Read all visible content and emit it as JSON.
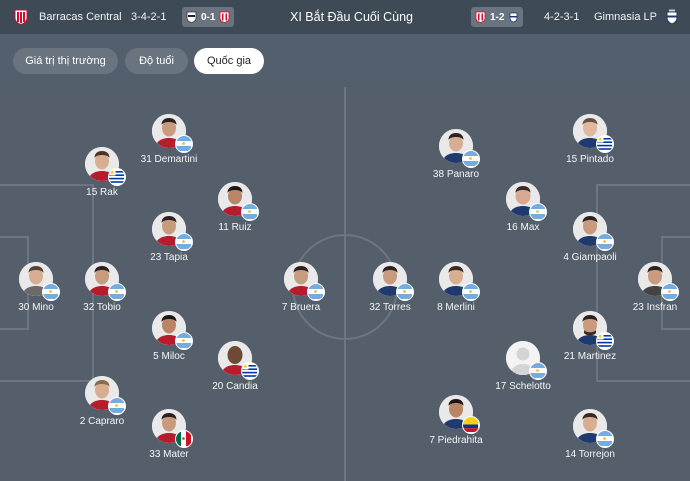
{
  "header": {
    "home_team": "Barracas Central",
    "home_formation": "3-4-2-1",
    "home_last_score": "0-1",
    "title": "XI Bắt Đầu Cuối Cùng",
    "away_last_score": "1-2",
    "away_formation": "4-2-3-1",
    "away_team": "Gimnasia LP"
  },
  "tabs": [
    {
      "label": "Giá trị thị trường",
      "active": false
    },
    {
      "label": "Độ tuổi",
      "active": false
    },
    {
      "label": "Quốc gia",
      "active": true
    }
  ],
  "home_players": [
    {
      "name": "31 Demartini",
      "flag": "argentina"
    },
    {
      "name": "15 Rak",
      "flag": "uruguay"
    },
    {
      "name": "11 Ruiz",
      "flag": "argentina"
    },
    {
      "name": "23 Tapia",
      "flag": "argentina"
    },
    {
      "name": "30 Mino",
      "flag": "argentina"
    },
    {
      "name": "32 Tobio",
      "flag": "argentina"
    },
    {
      "name": "7 Bruera",
      "flag": "argentina"
    },
    {
      "name": "5 Miloc",
      "flag": "argentina"
    },
    {
      "name": "20 Candia",
      "flag": "uruguay"
    },
    {
      "name": "2 Capraro",
      "flag": "argentina"
    },
    {
      "name": "33 Mater",
      "flag": "mexico"
    }
  ],
  "away_players": [
    {
      "name": "38 Panaro",
      "flag": "argentina"
    },
    {
      "name": "15 Pintado",
      "flag": "uruguay"
    },
    {
      "name": "16 Max",
      "flag": "argentina"
    },
    {
      "name": "4 Giampaoli",
      "flag": "argentina"
    },
    {
      "name": "32 Torres",
      "flag": "argentina"
    },
    {
      "name": "8 Merlini",
      "flag": "argentina"
    },
    {
      "name": "23 Insfran",
      "flag": "argentina"
    },
    {
      "name": "21 Martinez",
      "flag": "uruguay"
    },
    {
      "name": "17 Schelotto",
      "flag": "argentina"
    },
    {
      "name": "7 Piedrahita",
      "flag": "colombia"
    },
    {
      "name": "14 Torrejon",
      "flag": "argentina"
    }
  ],
  "colors": {
    "header_bg": "#3f4a57",
    "page_bg": "#545f6d",
    "pitch_lines": "#6c7683",
    "tab_inactive": "#6a7481",
    "tab_active": "#ffffff"
  }
}
